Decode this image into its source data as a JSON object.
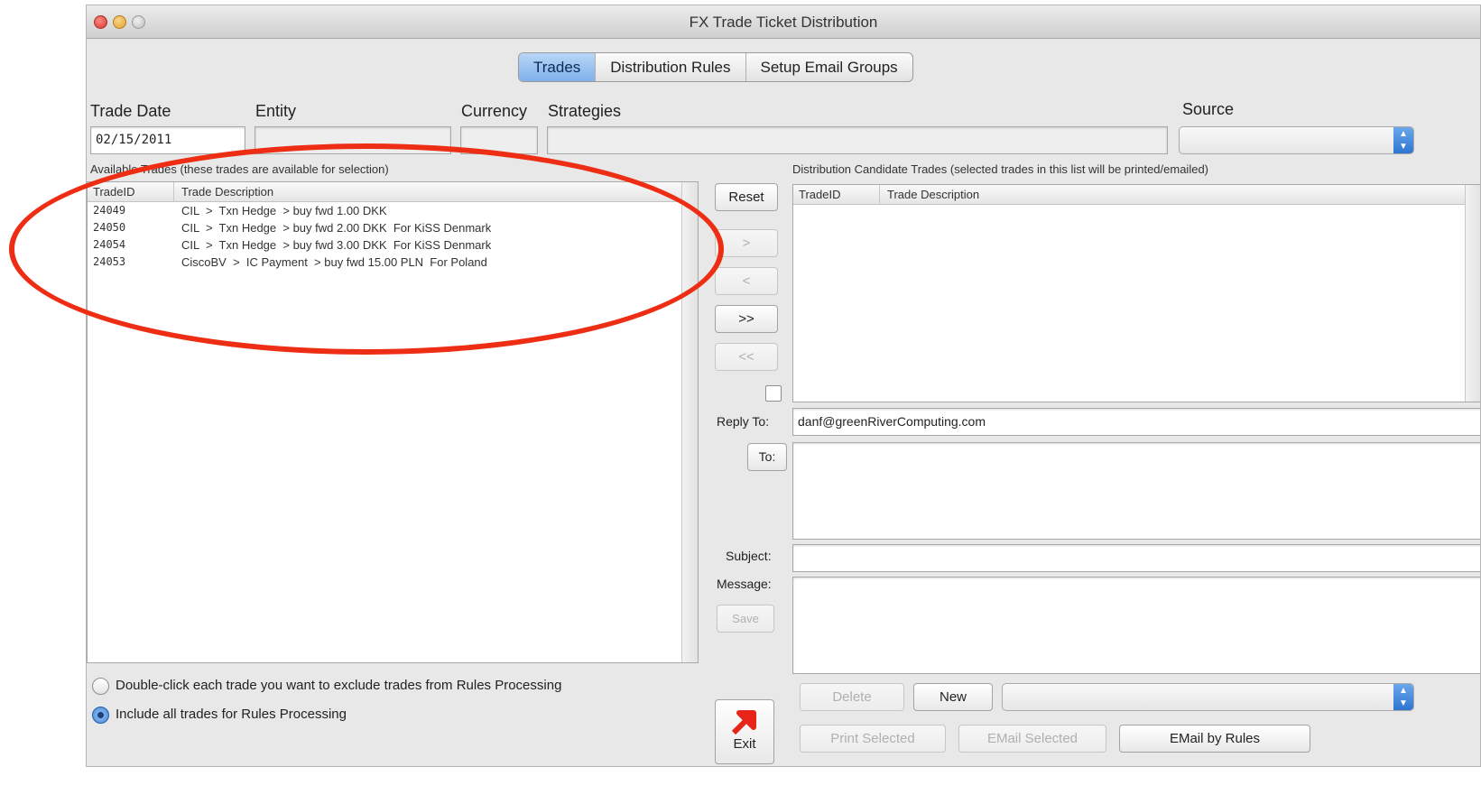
{
  "window": {
    "title": "FX Trade Ticket Distribution"
  },
  "tabs": [
    {
      "label": "Trades",
      "active": true
    },
    {
      "label": "Distribution Rules",
      "active": false
    },
    {
      "label": "Setup Email Groups",
      "active": false
    }
  ],
  "filters": {
    "trade_date_label": "Trade Date",
    "trade_date_value": "02/15/2011",
    "entity_label": "Entity",
    "entity_value": "",
    "currency_label": "Currency",
    "currency_value": "",
    "strategies_label": "Strategies",
    "strategies_value": "",
    "source_label": "Source",
    "source_value": ""
  },
  "available": {
    "caption": "Available Trades (these trades are available for selection)",
    "col_id": "TradeID",
    "col_desc": "Trade Description",
    "rows": [
      {
        "id": "24049",
        "desc": "CIL  >  Txn Hedge  > buy fwd 1.00 DKK"
      },
      {
        "id": "24050",
        "desc": "CIL  >  Txn Hedge  > buy fwd 2.00 DKK  For KiSS Denmark"
      },
      {
        "id": "24054",
        "desc": "CIL  >  Txn Hedge  > buy fwd 3.00 DKK  For KiSS Denmark"
      },
      {
        "id": "24053",
        "desc": "CiscoBV  >  IC Payment  > buy fwd 15.00 PLN  For Poland"
      }
    ]
  },
  "transfer": {
    "reset": "Reset",
    "move_right": ">",
    "move_left": "<",
    "move_all_right": ">>",
    "move_all_left": "<<"
  },
  "candidates": {
    "caption": "Distribution Candidate Trades (selected trades in this list will be printed/emailed)",
    "col_id": "TradeID",
    "col_desc": "Trade Description",
    "rows": []
  },
  "email": {
    "reply_to_label": "Reply To:",
    "reply_to_value": "danf@greenRiverComputing.com",
    "to_button": "To:",
    "to_value": "",
    "subject_label": "Subject:",
    "subject_value": "",
    "message_label": "Message:",
    "message_value": "",
    "save_button": "Save"
  },
  "options": {
    "exclude_label": "Double-click each trade you want to exclude trades from Rules Processing",
    "exclude_selected": false,
    "include_label": "Include all trades for Rules Processing",
    "include_selected": true
  },
  "actions": {
    "delete": "Delete",
    "new": "New",
    "group_select_value": "",
    "print_selected": "Print Selected",
    "email_selected": "EMail Selected",
    "email_by_rules": "EMail by Rules",
    "exit": "Exit"
  },
  "colors": {
    "annotation": "#ee2e14",
    "tab_active": "#7fb1ea",
    "exit_arrow": "#e8231a"
  }
}
